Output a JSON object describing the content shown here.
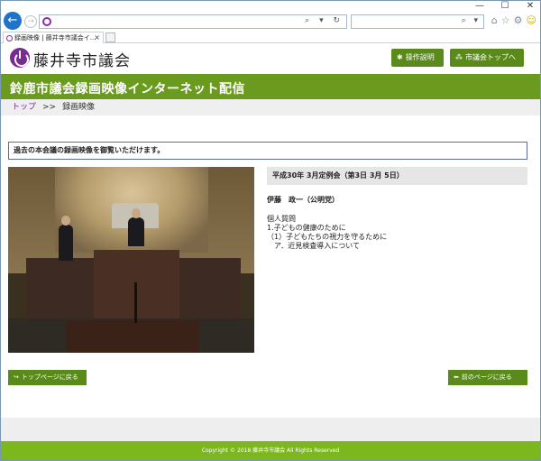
{
  "browser": {
    "tab_title": "録画映像 | 藤井寺市議会イ...",
    "tab_close": "×",
    "window_controls": [
      "—",
      "☐",
      "✕"
    ],
    "addr_controls": "⌕ ▾ ↻",
    "search_controls": "⌕ ▾",
    "tools": [
      "home-icon",
      "star-icon",
      "gear-icon",
      "smiley-icon"
    ],
    "tool_glyphs": [
      "⌂",
      "☆",
      "⚙",
      "☺"
    ],
    "accent_color": "#1f73c8"
  },
  "header": {
    "site_name": "藤井寺市議会",
    "help_button": "操作説明",
    "top_button": "市議会トップへ",
    "brand_color": "#7a2a93",
    "button_color": "#5a8a1a"
  },
  "banner": {
    "title": "鈴鹿市議会録画映像インターネット配信",
    "color": "#6a9b1f"
  },
  "breadcrumb": {
    "home": "トップ",
    "separator": ">>",
    "current": "録画映像"
  },
  "main": {
    "notice": "過去の本会議の録画映像を御覧いただけます。",
    "session": "平成30年 3月定例会（第3日 3月 5日）",
    "speaker": "伊藤　政一（公明党）",
    "question_type": "個人質問",
    "question_lines": [
      "1.子どもの健康のために",
      "（1）子どもたちの視力を守るために",
      "　ア．近見検査導入について"
    ]
  },
  "nav": {
    "home_button": "トップページに戻る",
    "back_button": "前のページに戻る"
  },
  "footer": {
    "copyright": "Copyright © 2018 藤井寺市議会 All Rights Reserved",
    "color": "#7cb71e"
  }
}
